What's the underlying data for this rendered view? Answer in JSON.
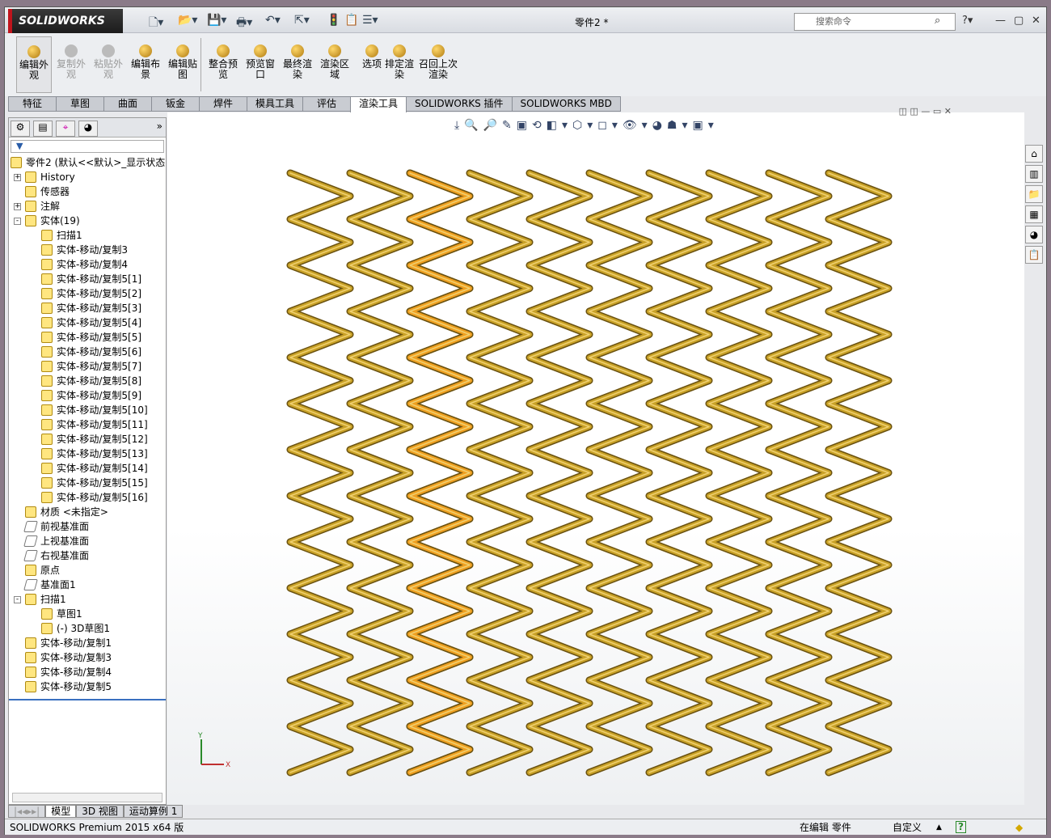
{
  "app": {
    "brand": "SOLIDWORKS",
    "title": "零件2 *",
    "search_placeholder": "搜索命令"
  },
  "ribbon": [
    {
      "label": "编辑外观",
      "state": "selected"
    },
    {
      "label": "复制外观",
      "state": "disabled"
    },
    {
      "label": "粘贴外观",
      "state": "disabled"
    },
    {
      "label": "编辑布景"
    },
    {
      "label": "编辑贴图"
    },
    {
      "label": "整合预览"
    },
    {
      "label": "预览窗口"
    },
    {
      "label": "最终渲染"
    },
    {
      "label": "渲染区域"
    },
    {
      "label": "选项"
    },
    {
      "label": "排定渲染"
    },
    {
      "label": "召回上次渲染"
    }
  ],
  "tabs": [
    "特征",
    "草图",
    "曲面",
    "钣金",
    "焊件",
    "模具工具",
    "评估",
    "渲染工具",
    "SOLIDWORKS 插件",
    "SOLIDWORKS MBD"
  ],
  "active_tab": "渲染工具",
  "tree": {
    "root": "零件2  (默认<<默认>_显示状态",
    "items": [
      {
        "label": "History",
        "level": 1,
        "exp": "+"
      },
      {
        "label": "传感器",
        "level": 1
      },
      {
        "label": "注解",
        "level": 1,
        "exp": "+"
      },
      {
        "label": "实体(19)",
        "level": 1,
        "exp": "-"
      },
      {
        "label": "扫描1",
        "level": 2
      },
      {
        "label": "实体-移动/复制3",
        "level": 2
      },
      {
        "label": "实体-移动/复制4",
        "level": 2
      },
      {
        "label": "实体-移动/复制5[1]",
        "level": 2
      },
      {
        "label": "实体-移动/复制5[2]",
        "level": 2
      },
      {
        "label": "实体-移动/复制5[3]",
        "level": 2
      },
      {
        "label": "实体-移动/复制5[4]",
        "level": 2
      },
      {
        "label": "实体-移动/复制5[5]",
        "level": 2
      },
      {
        "label": "实体-移动/复制5[6]",
        "level": 2
      },
      {
        "label": "实体-移动/复制5[7]",
        "level": 2
      },
      {
        "label": "实体-移动/复制5[8]",
        "level": 2
      },
      {
        "label": "实体-移动/复制5[9]",
        "level": 2
      },
      {
        "label": "实体-移动/复制5[10]",
        "level": 2
      },
      {
        "label": "实体-移动/复制5[11]",
        "level": 2
      },
      {
        "label": "实体-移动/复制5[12]",
        "level": 2
      },
      {
        "label": "实体-移动/复制5[13]",
        "level": 2
      },
      {
        "label": "实体-移动/复制5[14]",
        "level": 2
      },
      {
        "label": "实体-移动/复制5[15]",
        "level": 2
      },
      {
        "label": "实体-移动/复制5[16]",
        "level": 2
      },
      {
        "label": "材质 <未指定>",
        "level": 1
      },
      {
        "label": "前视基准面",
        "level": 1,
        "plane": true
      },
      {
        "label": "上视基准面",
        "level": 1,
        "plane": true
      },
      {
        "label": "右视基准面",
        "level": 1,
        "plane": true
      },
      {
        "label": "原点",
        "level": 1
      },
      {
        "label": "基准面1",
        "level": 1,
        "plane": true
      },
      {
        "label": "扫描1",
        "level": 1,
        "exp": "-"
      },
      {
        "label": "草图1",
        "level": 2
      },
      {
        "label": "(-) 3D草图1",
        "level": 2
      },
      {
        "label": "实体-移动/复制1",
        "level": 1
      },
      {
        "label": "实体-移动/复制3",
        "level": 1
      },
      {
        "label": "实体-移动/复制4",
        "level": 1
      },
      {
        "label": "实体-移动/复制5",
        "level": 1
      }
    ]
  },
  "bottom_tabs": [
    "模型",
    "3D 视图",
    "运动算例 1"
  ],
  "status": {
    "left": "SOLIDWORKS Premium 2015 x64 版",
    "editing": "在编辑 零件",
    "units": "自定义"
  },
  "axes": {
    "x": "X",
    "y": "Y"
  },
  "colors": {
    "wire": "#c9a227",
    "wire_dark": "#6b5210",
    "highlight": "#f0a020"
  }
}
